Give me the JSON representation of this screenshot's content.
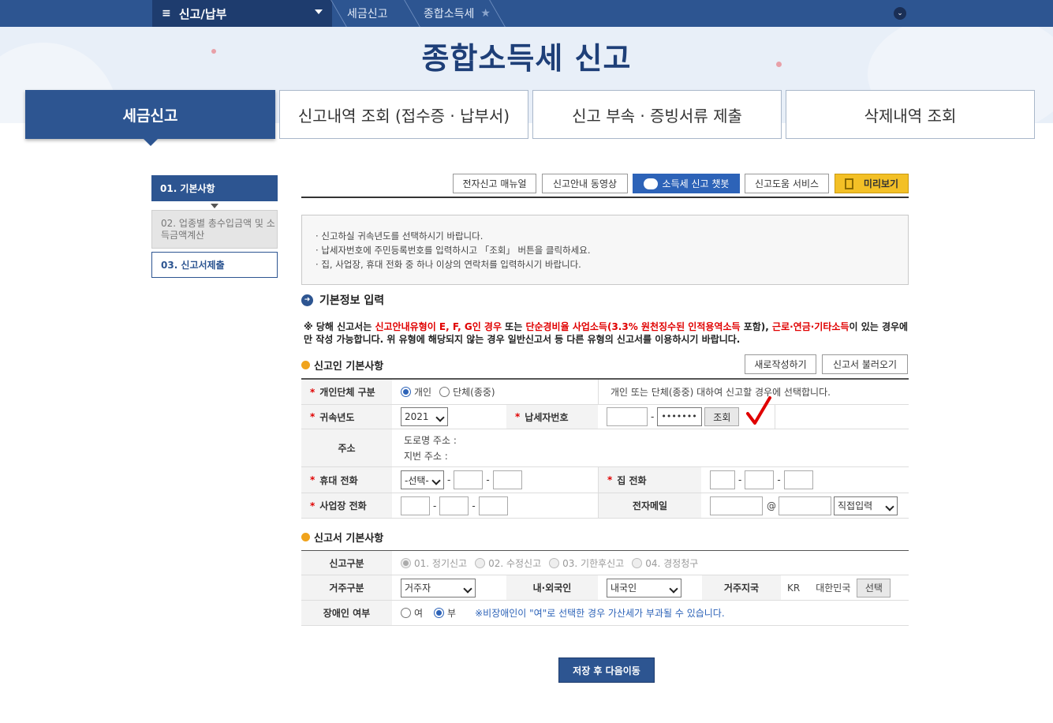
{
  "nav": {
    "menu_label": "신고/납부",
    "menu_icon": "≡",
    "breadcrumb1": "세금신고",
    "breadcrumb2": "종합소득세",
    "star_icon": "★",
    "chevron_icon": "⌄"
  },
  "hero": {
    "title": "종합소득세 신고"
  },
  "tabs": [
    {
      "label": "세금신고"
    },
    {
      "label": "신고내역 조회 (접수증 · 납부서)"
    },
    {
      "label": "신고 부속 · 증빙서류 제출"
    },
    {
      "label": "삭제내역 조회"
    }
  ],
  "steps": [
    {
      "label": "01. 기본사항"
    },
    {
      "label": "02. 업종별 총수입금액 및 소득금액계산"
    },
    {
      "label": "03. 신고서제출"
    }
  ],
  "toolbar": {
    "manual": "전자신고 매뉴얼",
    "video": "신고안내 동영상",
    "chatbot": "소득세 신고 챗봇",
    "help": "신고도움 서비스",
    "preview": "미리보기"
  },
  "guide": [
    "신고하실 귀속년도를 선택하시기 바랍니다.",
    "납세자번호에 주민등록번호를 입력하시고 「조회」 버튼을 클릭하세요.",
    "집, 사업장, 휴대 전화 중 하나 이상의 연락처를 입력하시기 바랍니다."
  ],
  "section": {
    "title": "기본정보 입력"
  },
  "notice": {
    "p1": "※ 당해 신고서는 ",
    "r1": "신고안내유형이 E, F, G인 경우",
    "p2": " 또는 ",
    "r2": "단순경비율 사업소득(3.3% 원천징수된 인적용역소득",
    "p3": " 포함), ",
    "r3": "근로·연금·기타소득",
    "p4": "이 있는 경우에만 작성 가능합니다. 위 유형에 해당되지 않는 경우 일반신고서 등 다른 유형의 신고서를 이용하시기 바랍니다."
  },
  "filer": {
    "title": "신고인 기본사항",
    "new_btn": "새로작성하기",
    "load_btn": "신고서 불러오기",
    "type_label": "개인단체 구분",
    "opt_individual": "개인",
    "opt_group": "단체(종중)",
    "type_help": "개인 또는 단체(종중) 대하여 신고할 경우에 선택합니다.",
    "year_label": "귀속년도",
    "year_value": "2021",
    "taxno_label": "납세자번호",
    "taxno_masked": "•••••••",
    "lookup_btn": "조회",
    "addr_label": "주소",
    "road_addr": "도로명 주소 :",
    "lot_addr": "지번 주소 :",
    "mobile_label": "휴대 전화",
    "mobile_select": "-선택-",
    "home_label": "집 전화",
    "biz_label": "사업장 전화",
    "email_label": "전자메일",
    "at": "@",
    "email_select": "직접입력"
  },
  "report": {
    "title": "신고서 기본사항",
    "kind_label": "신고구분",
    "kinds": [
      "01. 정기신고",
      "02. 수정신고",
      "03. 기한후신고",
      "04. 경정청구"
    ],
    "residence_label": "거주구분",
    "residence_value": "거주자",
    "nation_label": "내·외국인",
    "nation_value": "내국인",
    "country_label": "거주지국",
    "country_code": "KR",
    "country_name": "대한민국",
    "country_btn": "선택",
    "disabled_label": "장애인 여부",
    "opt_yes": "여",
    "opt_no": "부",
    "disabled_help": "※비장애인이 \"여\"로 선택한 경우 가산세가 부과될 수 있습니다."
  },
  "save_btn": "저장 후 다음이동",
  "colors": {
    "navy": "#2d5591",
    "dark_navy": "#1e3c6e",
    "red": "#e00000",
    "check": "#e00000"
  }
}
